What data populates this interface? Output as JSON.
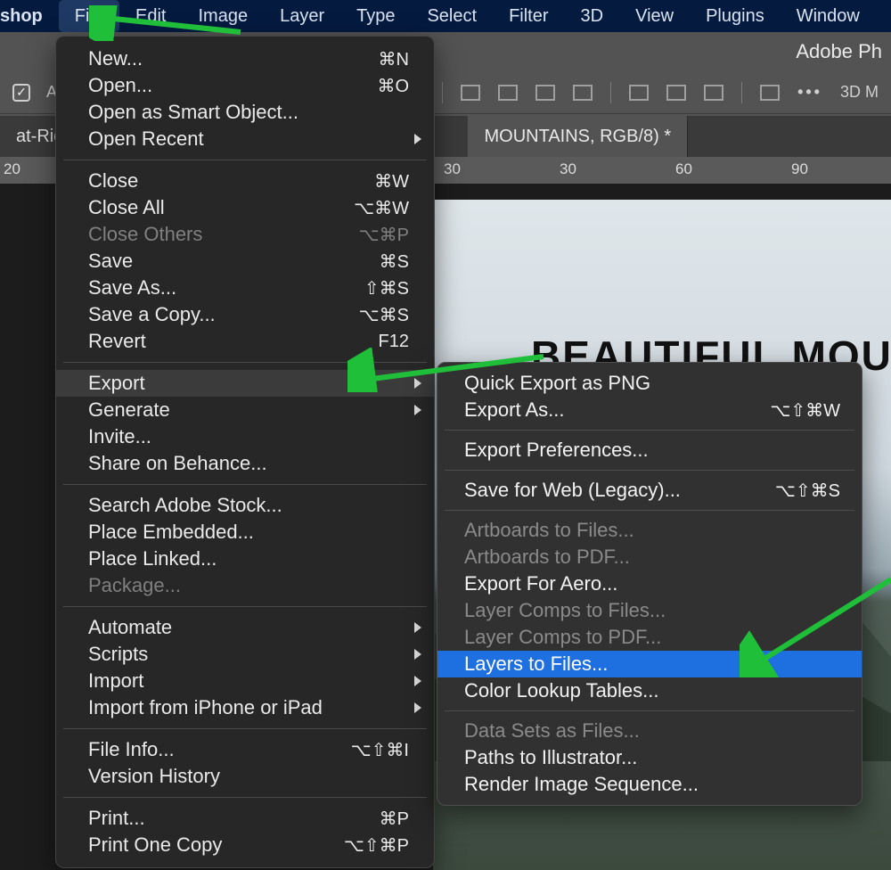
{
  "menubar": {
    "app": "shop",
    "items": [
      "File",
      "Edit",
      "Image",
      "Layer",
      "Type",
      "Select",
      "Filter",
      "3D",
      "View",
      "Plugins",
      "Window"
    ],
    "open_index": 0
  },
  "header_right": "Adobe Ph",
  "options_bar": {
    "checkbox_label_fragment": "A",
    "threeD_label": "3D M"
  },
  "tabs": {
    "left_fragment": "at-Ridg",
    "active": "MOUNTAINS, RGB/8) *"
  },
  "ruler_marks": {
    "m20": "20",
    "m30": "30",
    "m60": "60",
    "m90": "90"
  },
  "canvas_headline": "BEAUTIFUL MOU",
  "file_menu": {
    "groups": [
      [
        {
          "label": "New...",
          "shortcut": "⌘N"
        },
        {
          "label": "Open...",
          "shortcut": "⌘O"
        },
        {
          "label": "Open as Smart Object..."
        },
        {
          "label": "Open Recent",
          "submenu": true
        }
      ],
      [
        {
          "label": "Close",
          "shortcut": "⌘W"
        },
        {
          "label": "Close All",
          "shortcut": "⌥⌘W"
        },
        {
          "label": "Close Others",
          "shortcut": "⌥⌘P",
          "disabled": true
        },
        {
          "label": "Save",
          "shortcut": "⌘S"
        },
        {
          "label": "Save As...",
          "shortcut": "⇧⌘S"
        },
        {
          "label": "Save a Copy...",
          "shortcut": "⌥⌘S"
        },
        {
          "label": "Revert",
          "shortcut": "F12"
        }
      ],
      [
        {
          "label": "Export",
          "submenu": true,
          "hover": true
        },
        {
          "label": "Generate",
          "submenu": true
        },
        {
          "label": "Invite..."
        },
        {
          "label": "Share on Behance..."
        }
      ],
      [
        {
          "label": "Search Adobe Stock..."
        },
        {
          "label": "Place Embedded..."
        },
        {
          "label": "Place Linked..."
        },
        {
          "label": "Package...",
          "disabled": true
        }
      ],
      [
        {
          "label": "Automate",
          "submenu": true
        },
        {
          "label": "Scripts",
          "submenu": true
        },
        {
          "label": "Import",
          "submenu": true
        },
        {
          "label": "Import from iPhone or iPad",
          "submenu": true
        }
      ],
      [
        {
          "label": "File Info...",
          "shortcut": "⌥⇧⌘I"
        },
        {
          "label": "Version History"
        }
      ],
      [
        {
          "label": "Print...",
          "shortcut": "⌘P"
        },
        {
          "label": "Print One Copy",
          "shortcut": "⌥⇧⌘P"
        }
      ]
    ]
  },
  "export_submenu": {
    "groups": [
      [
        {
          "label": "Quick Export as PNG"
        },
        {
          "label": "Export As...",
          "shortcut": "⌥⇧⌘W"
        }
      ],
      [
        {
          "label": "Export Preferences..."
        }
      ],
      [
        {
          "label": "Save for Web (Legacy)...",
          "shortcut": "⌥⇧⌘S"
        }
      ],
      [
        {
          "label": "Artboards to Files...",
          "disabled": true
        },
        {
          "label": "Artboards to PDF...",
          "disabled": true
        },
        {
          "label": "Export For Aero..."
        },
        {
          "label": "Layer Comps to Files...",
          "disabled": true
        },
        {
          "label": "Layer Comps to PDF...",
          "disabled": true
        },
        {
          "label": "Layers to Files...",
          "selected": true
        },
        {
          "label": "Color Lookup Tables..."
        }
      ],
      [
        {
          "label": "Data Sets as Files...",
          "disabled": true
        },
        {
          "label": "Paths to Illustrator..."
        },
        {
          "label": "Render Image Sequence..."
        }
      ]
    ]
  }
}
